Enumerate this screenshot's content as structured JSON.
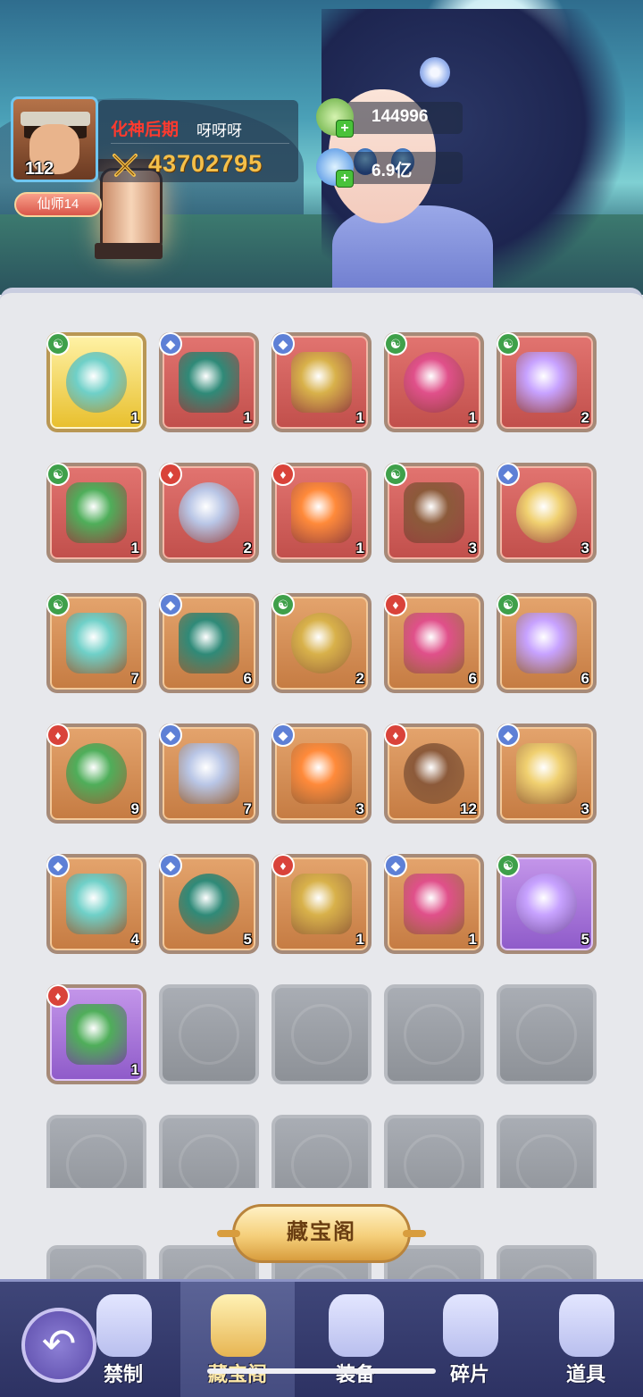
{
  "player": {
    "level": "112",
    "rank": "仙师14",
    "realm": "化神后期",
    "name": "呀呀呀",
    "combat_power": "43702795"
  },
  "resources": [
    {
      "icon": "jade-coin-icon",
      "value": "144996"
    },
    {
      "icon": "blue-crystal-icon",
      "value": "6.9亿"
    }
  ],
  "grid": {
    "slots": [
      {
        "name": "item-jade-flute",
        "bg": "gold",
        "badge": "yin",
        "count": "1",
        "icon": "hook-blade-icon"
      },
      {
        "name": "item-bronze-cauldron",
        "bg": "red",
        "badge": "drop",
        "count": "1",
        "icon": "cauldron-icon"
      },
      {
        "name": "item-bronze-bell",
        "bg": "red",
        "badge": "drop",
        "count": "1",
        "icon": "bell-icon"
      },
      {
        "name": "item-gold-plaque",
        "bg": "red",
        "badge": "yin",
        "count": "1",
        "icon": "plaque-icon"
      },
      {
        "name": "item-swirl-orb",
        "bg": "red",
        "badge": "yin",
        "count": "2",
        "icon": "orb-icon"
      },
      {
        "name": "item-jade-ring",
        "bg": "red",
        "badge": "yin",
        "count": "1",
        "icon": "ring-icon"
      },
      {
        "name": "item-spirit-skull",
        "bg": "red",
        "badge": "fire",
        "count": "2",
        "icon": "skull-icon"
      },
      {
        "name": "item-feather-fan",
        "bg": "red",
        "badge": "fire",
        "count": "1",
        "icon": "fan-icon"
      },
      {
        "name": "item-green-gourd",
        "bg": "red",
        "badge": "yin",
        "count": "3",
        "icon": "gourd-icon"
      },
      {
        "name": "item-vajra",
        "bg": "red",
        "badge": "drop",
        "count": "3",
        "icon": "vajra-icon"
      },
      {
        "name": "item-book-stack",
        "bg": "orange",
        "badge": "yin",
        "count": "7",
        "icon": "books-icon"
      },
      {
        "name": "item-dragon-mirror",
        "bg": "orange",
        "badge": "drop",
        "count": "6",
        "icon": "mirror-icon"
      },
      {
        "name": "item-armor",
        "bg": "orange",
        "badge": "yin",
        "count": "2",
        "icon": "armor-icon"
      },
      {
        "name": "item-flame-pearl",
        "bg": "orange",
        "badge": "fire",
        "count": "6",
        "icon": "pearl-icon"
      },
      {
        "name": "item-gold-ore",
        "bg": "orange",
        "badge": "yin",
        "count": "6",
        "icon": "ore-icon"
      },
      {
        "name": "item-stone-tablet",
        "bg": "orange",
        "badge": "fire",
        "count": "9",
        "icon": "tablet-icon"
      },
      {
        "name": "item-gold-bell",
        "bg": "orange",
        "badge": "drop",
        "count": "7",
        "icon": "gold-bell-icon"
      },
      {
        "name": "item-beast-seal",
        "bg": "orange",
        "badge": "drop",
        "count": "3",
        "icon": "seal-icon"
      },
      {
        "name": "item-red-beast",
        "bg": "orange",
        "badge": "fire",
        "count": "12",
        "icon": "beast-icon"
      },
      {
        "name": "item-gold-censer",
        "bg": "orange",
        "badge": "drop",
        "count": "3",
        "icon": "censer-icon"
      },
      {
        "name": "item-gold-axe",
        "bg": "orange",
        "badge": "drop",
        "count": "4",
        "icon": "axe-icon"
      },
      {
        "name": "item-war-drum",
        "bg": "orange",
        "badge": "drop",
        "count": "5",
        "icon": "drum-icon"
      },
      {
        "name": "item-thorn-ring",
        "bg": "orange",
        "badge": "fire",
        "count": "1",
        "icon": "thorn-ring-icon"
      },
      {
        "name": "item-iron-censer",
        "bg": "orange",
        "badge": "drop",
        "count": "1",
        "icon": "iron-censer-icon"
      },
      {
        "name": "item-purple-scroll",
        "bg": "purple",
        "badge": "yin",
        "count": "5",
        "icon": "scroll-icon"
      },
      {
        "name": "item-red-scroll",
        "bg": "purple",
        "badge": "fire",
        "count": "1",
        "icon": "red-scroll-icon"
      }
    ],
    "empty_slots": 14
  },
  "treasure_button": "藏宝阁",
  "nav": {
    "back_icon": "back-arrow-icon",
    "items": [
      {
        "label": "禁制",
        "icon": "flame-icon"
      },
      {
        "label": "藏宝阁",
        "icon": "pavilion-icon",
        "active": true
      },
      {
        "label": "装备",
        "icon": "armor-icon"
      },
      {
        "label": "碎片",
        "icon": "shards-icon"
      },
      {
        "label": "道具",
        "icon": "pouch-icon"
      }
    ]
  },
  "colors": {
    "realm_text": "#ff3a2e",
    "power_text": "#f4c04a",
    "nav_bg": "#2d3263"
  }
}
